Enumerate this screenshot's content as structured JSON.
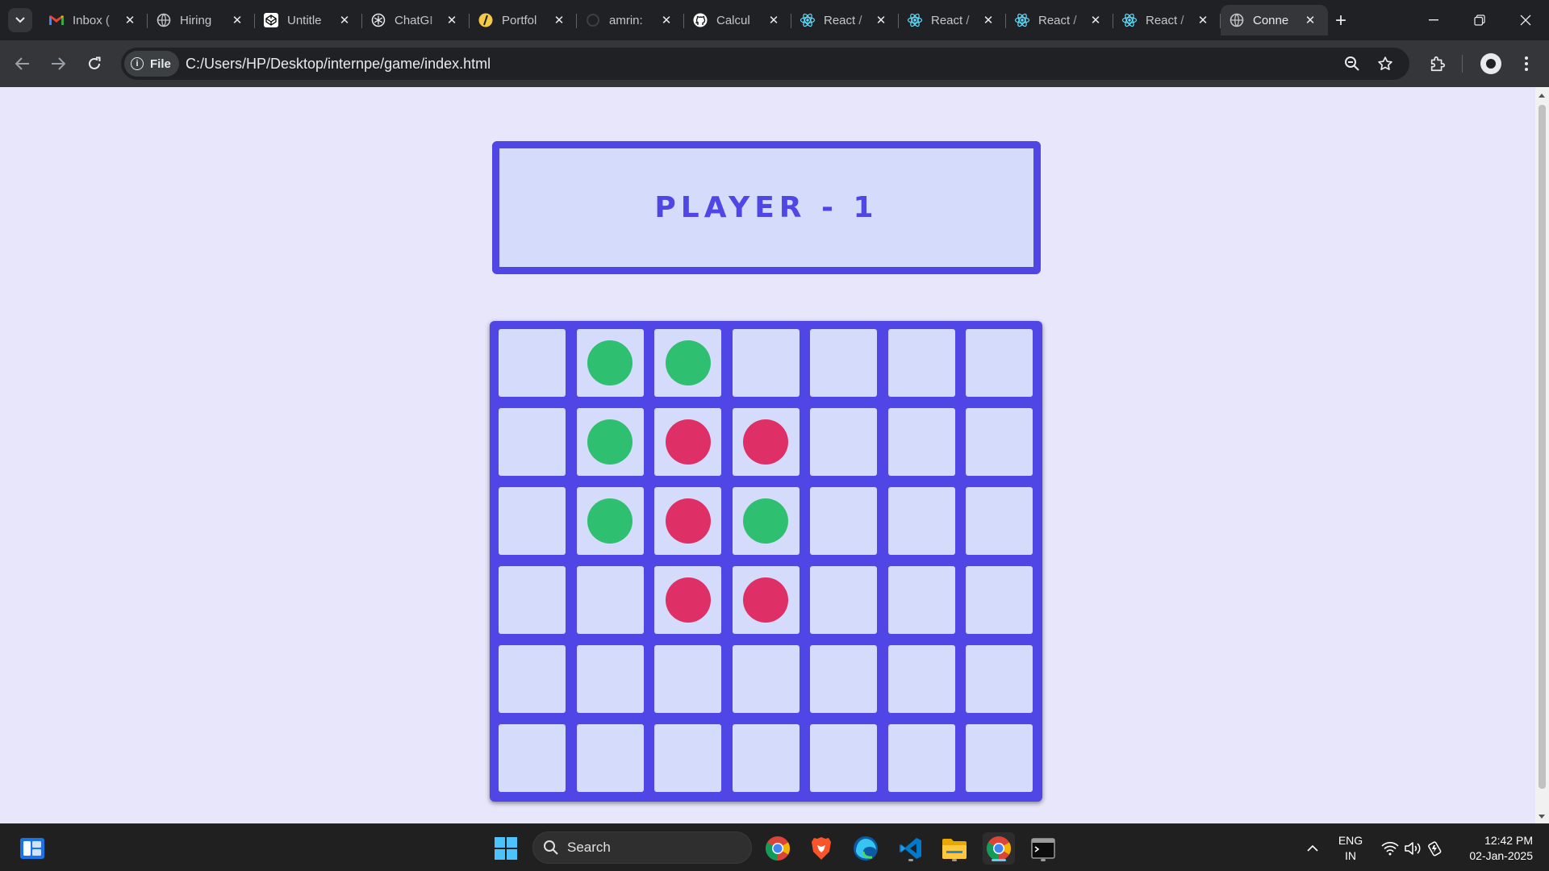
{
  "browser": {
    "tabs": [
      {
        "title": "Inbox (",
        "icon": "gmail-icon"
      },
      {
        "title": "Hiring",
        "icon": "globe-icon"
      },
      {
        "title": "Untitle",
        "icon": "codepen-icon"
      },
      {
        "title": "ChatGI",
        "icon": "chatgpt-icon"
      },
      {
        "title": "Portfol",
        "icon": "portfolio-icon"
      },
      {
        "title": "amrin:",
        "icon": "loading-icon"
      },
      {
        "title": "Calcul",
        "icon": "github-icon"
      },
      {
        "title": "React /",
        "icon": "react-icon"
      },
      {
        "title": "React /",
        "icon": "react-icon"
      },
      {
        "title": "React /",
        "icon": "react-icon"
      },
      {
        "title": "React /",
        "icon": "react-icon"
      },
      {
        "title": "Conne",
        "icon": "globe-icon",
        "active": true
      }
    ],
    "chip_label": "File",
    "url": "C:/Users/HP/Desktop/internpe/game/index.html"
  },
  "game": {
    "player_label": "PLAYER - 1",
    "colors": {
      "green": "#2fbf71",
      "red": "#de2f66",
      "board": "#4f46e5",
      "cell": "#d5dcfb"
    },
    "board": [
      [
        "",
        "green",
        "green",
        "",
        "",
        "",
        ""
      ],
      [
        "",
        "green",
        "red",
        "red",
        "",
        "",
        ""
      ],
      [
        "",
        "green",
        "red",
        "green",
        "",
        "",
        ""
      ],
      [
        "",
        "",
        "red",
        "red",
        "",
        "",
        ""
      ],
      [
        "",
        "",
        "",
        "",
        "",
        "",
        ""
      ],
      [
        "",
        "",
        "",
        "",
        "",
        "",
        ""
      ]
    ]
  },
  "taskbar": {
    "search_label": "Search",
    "apps": [
      "chrome-icon",
      "brave-icon",
      "edge-icon",
      "vscode-icon",
      "file-explorer-icon",
      "chrome-icon",
      "terminal-icon"
    ],
    "language": {
      "line1": "ENG",
      "line2": "IN"
    },
    "time": "12:42 PM",
    "date": "02-Jan-2025"
  }
}
